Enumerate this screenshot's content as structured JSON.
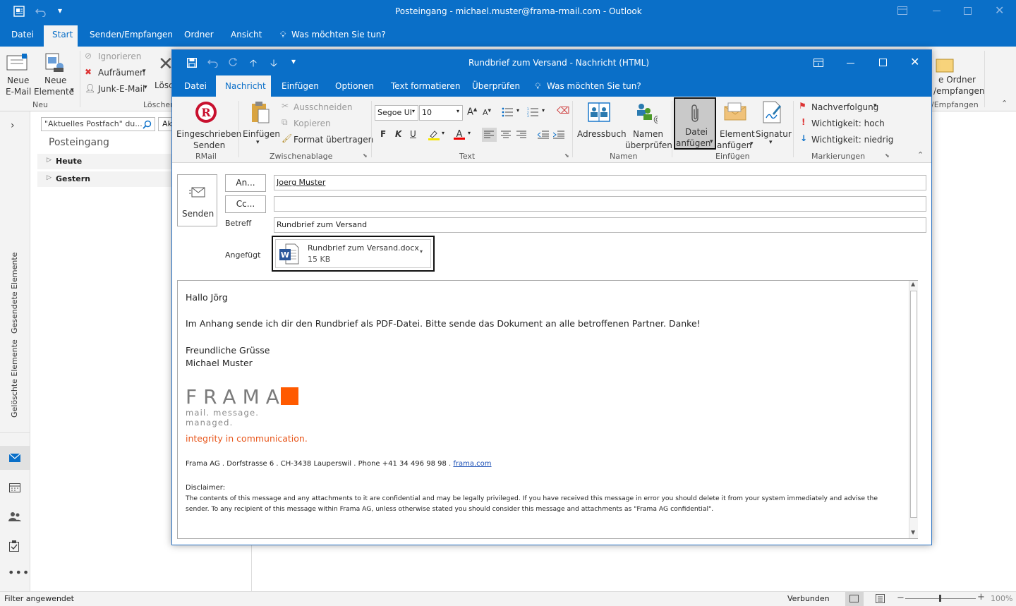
{
  "window": {
    "title": "Posteingang - michael.muster@frama-rmail.com  -  Outlook"
  },
  "menu": {
    "tabs": [
      "Datei",
      "Start",
      "Senden/Empfangen",
      "Ordner",
      "Ansicht"
    ],
    "tell_me": "Was möchten Sie tun?"
  },
  "main_ribbon": {
    "new_email": [
      "Neue",
      "E-Mail"
    ],
    "new_items": [
      "Neue",
      "Elemente"
    ],
    "ignore": "Ignorieren",
    "cleanup": "Aufräumen",
    "junk": "Junk-E-Mail",
    "delete_partial": "Lösc",
    "group_new": "Neu",
    "group_delete": "Löschen",
    "move_folder": [
      "e Ordner",
      "/empfangen"
    ],
    "group_send": "/Empfangen"
  },
  "nav": {
    "sent": "Gesendete Elemente",
    "deleted": "Gelöschte Elemente"
  },
  "folder": {
    "search_placeholder": "\"Aktuelles Postfach\" du...",
    "scope_partial": "Ak",
    "title": "Posteingang",
    "groups": [
      "Heute",
      "Gestern"
    ]
  },
  "status": {
    "left": "Filter angewendet",
    "connection": "Verbunden",
    "zoom": "100%"
  },
  "compose": {
    "title": "Rundbrief zum Versand  -  Nachricht (HTML)",
    "tabs": [
      "Datei",
      "Nachricht",
      "Einfügen",
      "Optionen",
      "Text formatieren",
      "Überprüfen"
    ],
    "tell_me": "Was möchten Sie tun?",
    "ribbon": {
      "rmail_btn": [
        "Eingeschrieben",
        "Senden"
      ],
      "group_rmail": "RMail",
      "paste": "Einfügen",
      "cut": "Ausschneiden",
      "copy": "Kopieren",
      "format_painter": "Format übertragen",
      "group_clipboard": "Zwischenablage",
      "font_name": "Segoe UI",
      "font_size": "10",
      "group_text": "Text",
      "address_book": "Adressbuch",
      "check_names": [
        "Namen",
        "überprüfen"
      ],
      "group_names": "Namen",
      "attach_file": [
        "Datei",
        "anfügen"
      ],
      "attach_item": [
        "Element",
        "anfügen"
      ],
      "signature": "Signatur",
      "group_insert": "Einfügen",
      "followup": "Nachverfolgung",
      "importance_high": "Wichtigkeit: hoch",
      "importance_low": "Wichtigkeit: niedrig",
      "group_tags": "Markierungen"
    },
    "send_label": "Senden",
    "to_label": "An...",
    "cc_label": "Cc...",
    "subject_label": "Betreff",
    "attached_label": "Angefügt",
    "to_value": "Joerg Muster",
    "cc_value": "",
    "subject_value": "Rundbrief zum Versand",
    "attachment": {
      "name": "Rundbrief zum Versand.docx",
      "size": "15 KB"
    },
    "body": {
      "greeting": "Hallo Jörg",
      "line1": "Im Anhang sende ich dir den Rundbrief als PDF-Datei. Bitte sende das Dokument an alle betroffenen Partner. Danke!",
      "closing": "Freundliche Grüsse",
      "name": "Michael Muster",
      "logo_word": "FRAMA",
      "logo_tagline": "mail. message. managed.",
      "slogan": "integrity in communication.",
      "address": "Frama AG . Dorfstrasse 6 . CH-3438 Lauperswil . Phone +41 34 496 98 98 . ",
      "link": "frama.com",
      "disclaimer_title": "Disclaimer:",
      "disclaimer_1": "The contents of this message and any attachments to it are confidential and may be legally privileged. If you have received this message in error you should delete it from your system immediately and advise the",
      "disclaimer_2": "sender. To any recipient of this message within Frama AG, unless otherwise stated you should consider this message and attachments as \"Frama AG confidential\"."
    }
  },
  "colors": {
    "accent": "#0a6fc8",
    "slogan": "#e8561b",
    "logo_square": "#ff5a00"
  }
}
